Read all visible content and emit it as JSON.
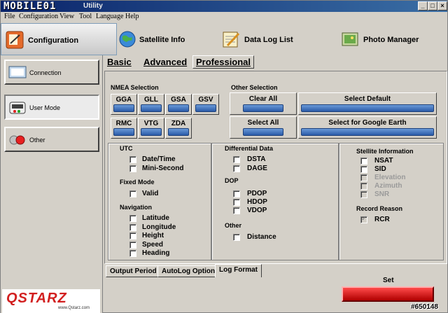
{
  "window": {
    "logo_text": "MOBILE01",
    "title": "Utility",
    "min_glyph": "_",
    "max_glyph": "□",
    "close_glyph": "×"
  },
  "menu": [
    "File",
    "Configuration",
    "View",
    "Tool",
    "Language",
    "Help"
  ],
  "top_tabs": [
    {
      "label": "Configuration",
      "icon": "configuration-icon"
    },
    {
      "label": "Satellite Info",
      "icon": "globe-icon"
    },
    {
      "label": "Data Log List",
      "icon": "notepad-icon"
    },
    {
      "label": "Photo Manager",
      "icon": "photo-icon"
    }
  ],
  "sidebar": {
    "items": [
      {
        "label": "Connection",
        "icon": "connection-icon"
      },
      {
        "label": "User Mode",
        "icon": "device-icon"
      },
      {
        "label": "Other",
        "icon": "red-dots-icon"
      }
    ],
    "brand": "QSTARZ",
    "brand_url": "www.Qstarz.com"
  },
  "sub_tabs": [
    "Basic",
    "Advanced",
    "Professional"
  ],
  "nmea": {
    "title": "NMEA Selection",
    "buttons": [
      "GGA",
      "GLL",
      "GSA",
      "GSV",
      "RMC",
      "VTG",
      "ZDA"
    ]
  },
  "other_selection": {
    "title": "Other Selection",
    "clear_all": "Clear All",
    "select_default": "Select Default",
    "select_all": "Select All",
    "select_google_earth": "Select for Google Earth"
  },
  "utc": {
    "title": "UTC",
    "items": [
      "Date/Time",
      "Mini-Second"
    ]
  },
  "fixed_mode": {
    "title": "Fixed Mode",
    "items": [
      "Valid"
    ]
  },
  "navigation": {
    "title": "Navigation",
    "items": [
      "Latitude",
      "Longitude",
      "Height",
      "Speed",
      "Heading"
    ]
  },
  "differential": {
    "title": "Differential Data",
    "items": [
      "DSTA",
      "DAGE"
    ]
  },
  "dop": {
    "title": "DOP",
    "items": [
      "PDOP",
      "HDOP",
      "VDOP"
    ]
  },
  "other": {
    "title": "Other",
    "items": [
      "Distance"
    ]
  },
  "satellite": {
    "title": "Stellite Information",
    "items": [
      "NSAT",
      "SID",
      "Elevation",
      "Azimuth",
      "SNR"
    ]
  },
  "record_reason": {
    "title": "Record Reason",
    "items": [
      "RCR"
    ]
  },
  "bottom_tabs": [
    "Output Period",
    "AutoLog Option",
    "Log Format"
  ],
  "set": {
    "label": "Set"
  },
  "watermark": "#650148"
}
